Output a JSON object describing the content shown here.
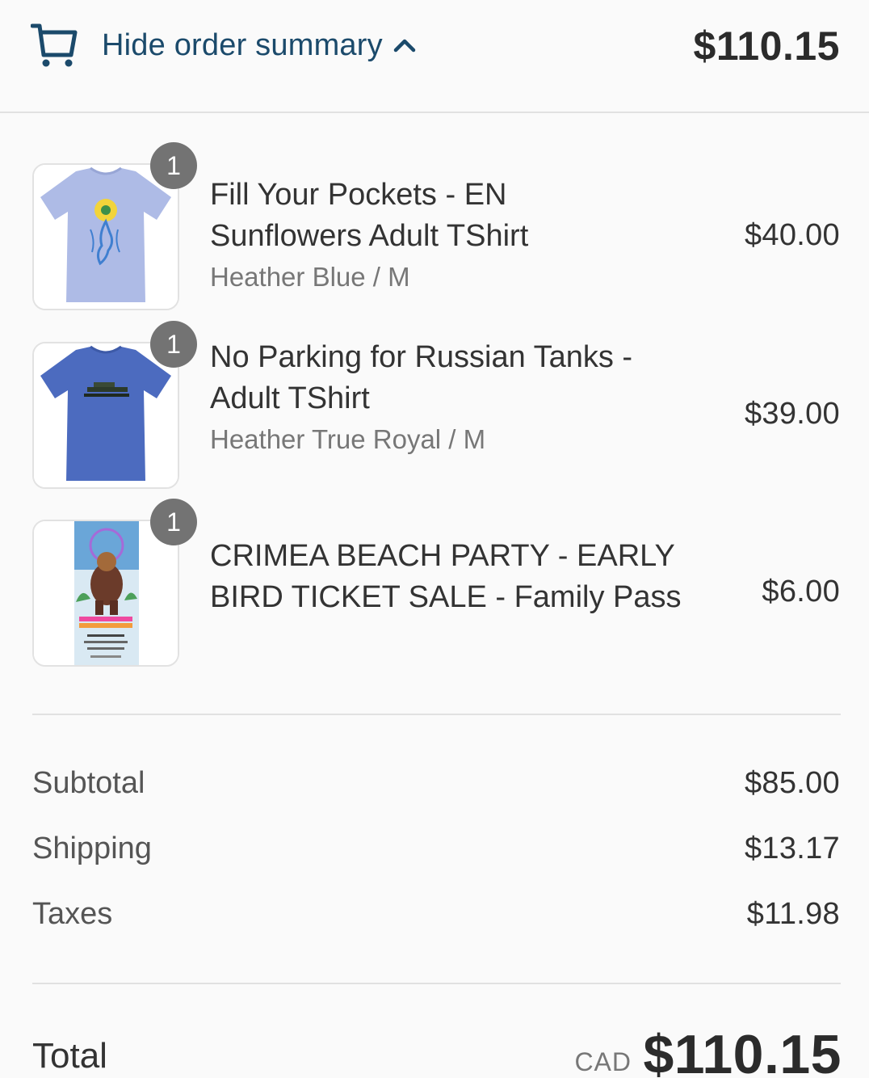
{
  "header": {
    "toggle_label": "Hide order summary",
    "cart_icon": "cart-icon",
    "chevron_icon": "chevron-up-icon",
    "total": "$110.15",
    "link_color": "#1b4a6b"
  },
  "items": [
    {
      "quantity": "1",
      "title_line1": "Fill Your Pockets - EN",
      "title_line2": "Sunflowers Adult TShirt",
      "variant": "Heather Blue / M",
      "price": "$40.00",
      "shirt_color": "#aebbe6"
    },
    {
      "quantity": "1",
      "title_line1": "No Parking for Russian Tanks -",
      "title_line2": "Adult TShirt",
      "variant": "Heather True Royal / M",
      "price": "$39.00",
      "shirt_color": "#4c6bbf"
    },
    {
      "quantity": "1",
      "title_line1": "CRIMEA BEACH PARTY - EARLY",
      "title_line2": "BIRD TICKET SALE - Family Pass",
      "variant": "",
      "price": "$6.00"
    }
  ],
  "summary": {
    "subtotal_label": "Subtotal",
    "subtotal_value": "$85.00",
    "shipping_label": "Shipping",
    "shipping_value": "$13.17",
    "taxes_label": "Taxes",
    "taxes_value": "$11.98"
  },
  "total": {
    "label": "Total",
    "currency": "CAD",
    "value": "$110.15"
  }
}
